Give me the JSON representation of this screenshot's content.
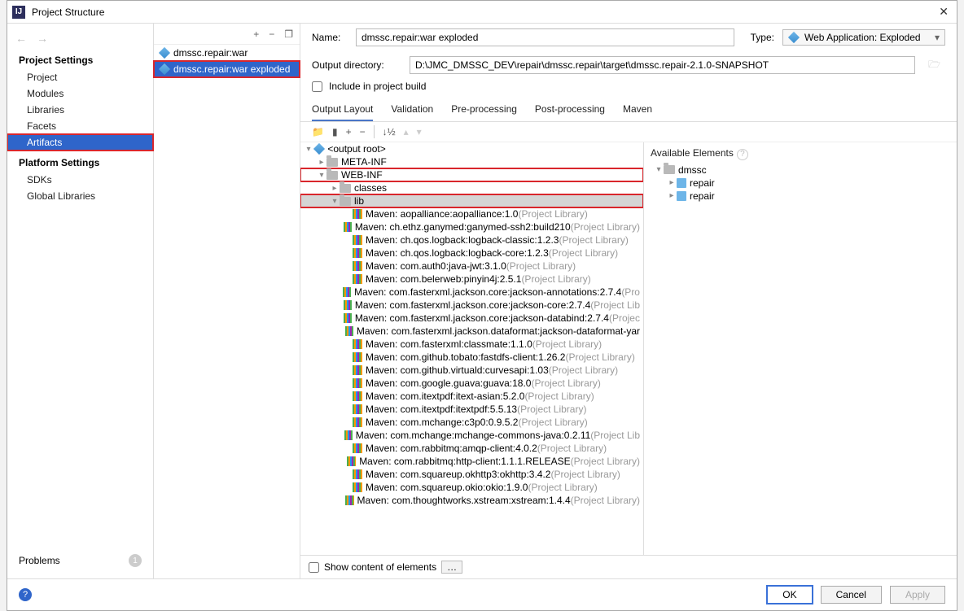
{
  "window": {
    "title": "Project Structure"
  },
  "sidebar": {
    "section1": "Project Settings",
    "items1": [
      "Project",
      "Modules",
      "Libraries",
      "Facets",
      "Artifacts"
    ],
    "section2": "Platform Settings",
    "items2": [
      "SDKs",
      "Global Libraries"
    ],
    "problems": "Problems",
    "problems_count": "1"
  },
  "artifacts": {
    "items": [
      {
        "label": "dmssc.repair:war"
      },
      {
        "label": "dmssc.repair:war exploded"
      }
    ]
  },
  "form": {
    "name_label": "Name:",
    "name_value": "dmssc.repair:war exploded",
    "type_label": "Type:",
    "type_value": "Web Application: Exploded",
    "outdir_label": "Output directory:",
    "outdir_value": "D:\\JMC_DMSSC_DEV\\repair\\dmssc.repair\\target\\dmssc.repair-2.1.0-SNAPSHOT",
    "include_label": "Include in project build"
  },
  "tabs": [
    "Output Layout",
    "Validation",
    "Pre-processing",
    "Post-processing",
    "Maven"
  ],
  "tree": {
    "root": "<output root>",
    "metainf": "META-INF",
    "webinf": "WEB-INF",
    "classes": "classes",
    "lib": "lib",
    "libs": [
      {
        "n": "Maven: aopalliance:aopalliance:1.0",
        "s": "(Project Library)"
      },
      {
        "n": "Maven: ch.ethz.ganymed:ganymed-ssh2:build210",
        "s": "(Project Library)"
      },
      {
        "n": "Maven: ch.qos.logback:logback-classic:1.2.3",
        "s": "(Project Library)"
      },
      {
        "n": "Maven: ch.qos.logback:logback-core:1.2.3",
        "s": "(Project Library)"
      },
      {
        "n": "Maven: com.auth0:java-jwt:3.1.0",
        "s": "(Project Library)"
      },
      {
        "n": "Maven: com.belerweb:pinyin4j:2.5.1",
        "s": "(Project Library)"
      },
      {
        "n": "Maven: com.fasterxml.jackson.core:jackson-annotations:2.7.4",
        "s": "(Pro"
      },
      {
        "n": "Maven: com.fasterxml.jackson.core:jackson-core:2.7.4",
        "s": "(Project Lib"
      },
      {
        "n": "Maven: com.fasterxml.jackson.core:jackson-databind:2.7.4",
        "s": "(Projec"
      },
      {
        "n": "Maven: com.fasterxml.jackson.dataformat:jackson-dataformat-yar",
        "s": ""
      },
      {
        "n": "Maven: com.fasterxml:classmate:1.1.0",
        "s": "(Project Library)"
      },
      {
        "n": "Maven: com.github.tobato:fastdfs-client:1.26.2",
        "s": "(Project Library)"
      },
      {
        "n": "Maven: com.github.virtuald:curvesapi:1.03",
        "s": "(Project Library)"
      },
      {
        "n": "Maven: com.google.guava:guava:18.0",
        "s": "(Project Library)"
      },
      {
        "n": "Maven: com.itextpdf:itext-asian:5.2.0",
        "s": "(Project Library)"
      },
      {
        "n": "Maven: com.itextpdf:itextpdf:5.5.13",
        "s": "(Project Library)"
      },
      {
        "n": "Maven: com.mchange:c3p0:0.9.5.2",
        "s": "(Project Library)"
      },
      {
        "n": "Maven: com.mchange:mchange-commons-java:0.2.11",
        "s": "(Project Lib"
      },
      {
        "n": "Maven: com.rabbitmq:amqp-client:4.0.2",
        "s": "(Project Library)"
      },
      {
        "n": "Maven: com.rabbitmq:http-client:1.1.1.RELEASE",
        "s": "(Project Library)"
      },
      {
        "n": "Maven: com.squareup.okhttp3:okhttp:3.4.2",
        "s": "(Project Library)"
      },
      {
        "n": "Maven: com.squareup.okio:okio:1.9.0",
        "s": "(Project Library)"
      },
      {
        "n": "Maven: com.thoughtworks.xstream:xstream:1.4.4",
        "s": "(Project Library)"
      }
    ]
  },
  "avail": {
    "title": "Available Elements",
    "root": "dmssc",
    "child1": "repair",
    "child2": "repair"
  },
  "bottom": {
    "show": "Show content of elements"
  },
  "footer": {
    "ok": "OK",
    "cancel": "Cancel",
    "apply": "Apply"
  }
}
